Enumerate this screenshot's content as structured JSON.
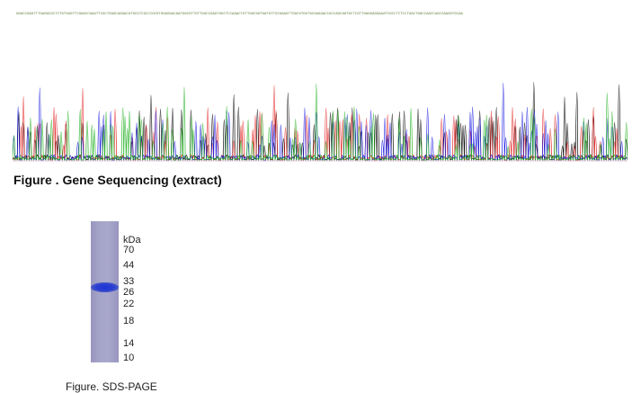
{
  "sequence": {
    "text": "GGACCGAGTTTGAGGCGCTCTGTGGGTTCGGACCGAATTCGCTGGACAGGACGTGCGTCGCCCGCGTGGAGGACAATGGCGTTGTTGGCCGAGTGGCTCCAAACTGTTGGCGGTGATGTTGCGAAGTTGGCGTGGTGCGAAGACCACCAGCAGTGCTCGTTGAGGAGGAAATCGCCTCTCCTGACTGGCCAACCAGCCAAGGTGCAA"
  },
  "chromatogram": {
    "trace_colors": [
      "#000000",
      "#e32222",
      "#1a1ae0",
      "#22b022"
    ]
  },
  "figure1": {
    "caption": "Figure . Gene Sequencing (extract)"
  },
  "gel": {
    "lane_color": "#a3a2c8",
    "band_color": "#2438d4",
    "unit_label": "kDa",
    "markers": [
      "70",
      "44",
      "33",
      "26",
      "22",
      "18",
      "14",
      "10"
    ]
  },
  "figure2": {
    "caption": "Figure. SDS-PAGE"
  }
}
